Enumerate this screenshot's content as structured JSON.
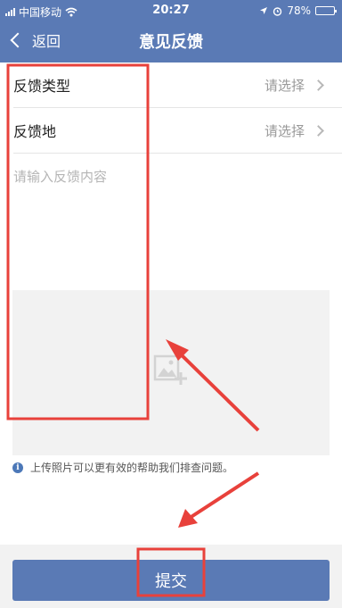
{
  "status_bar": {
    "carrier": "中国移动",
    "time": "20:27",
    "battery": "78%",
    "battery_level": 0.78,
    "icons": [
      "signal-icon",
      "wifi-icon",
      "location-icon",
      "alarm-icon",
      "battery-icon"
    ]
  },
  "nav": {
    "back_label": "返回",
    "title": "意见反馈"
  },
  "form": {
    "type_row": {
      "label": "反馈类型",
      "value": "请选择"
    },
    "place_row": {
      "label": "反馈地",
      "value": "请选择"
    },
    "content": {
      "placeholder": "请输入反馈内容",
      "value": ""
    },
    "upload_icon": "add-image-icon",
    "tip": "上传照片可以更有效的帮助我们排查问题。"
  },
  "submit_label": "提交",
  "colors": {
    "primary": "#5a7ab5",
    "annotation_red": "#e8413b",
    "placeholder": "#999999"
  }
}
